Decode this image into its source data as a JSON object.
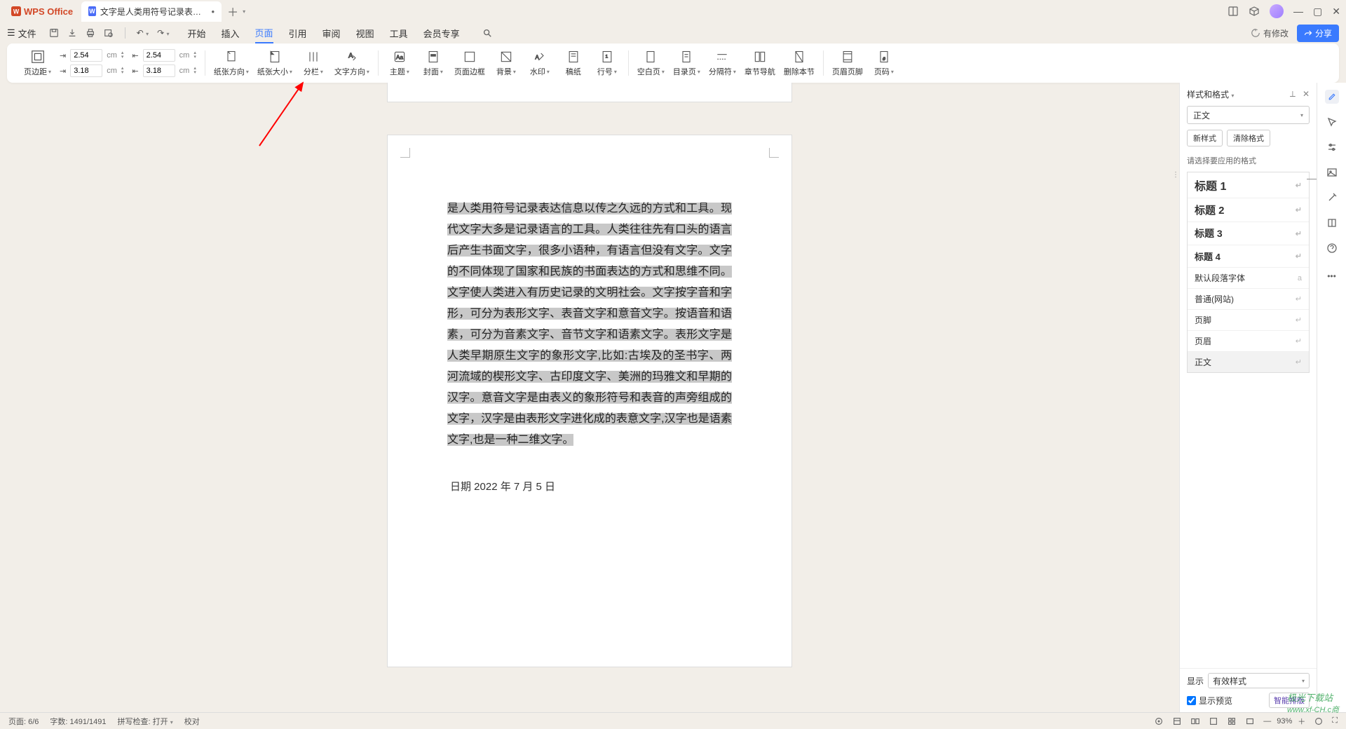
{
  "app": {
    "name": "WPS Office"
  },
  "tab": {
    "title": "文字是人类用符号记录表达信息以…"
  },
  "menubar": {
    "file": "文件",
    "tabs": [
      "开始",
      "插入",
      "页面",
      "引用",
      "审阅",
      "视图",
      "工具",
      "会员专享"
    ],
    "active_index": 2,
    "modified": "有修改",
    "share": "分享"
  },
  "ribbon": {
    "margins": {
      "label": "页边距",
      "top": "2.54",
      "bottom": "2.54",
      "left": "3.18",
      "right": "3.18",
      "unit": "cm"
    },
    "buttons": {
      "paper_orient": "纸张方向",
      "paper_size": "纸张大小",
      "columns": "分栏",
      "text_dir": "文字方向",
      "theme": "主题",
      "cover": "封面",
      "page_border": "页面边框",
      "background": "背景",
      "watermark": "水印",
      "manuscript": "稿纸",
      "line_no": "行号",
      "blank_page": "空白页",
      "toc_page": "目录页",
      "section_break": "分隔符",
      "chapter_nav": "章节导航",
      "delete_section": "删除本节",
      "header_footer": "页眉页脚",
      "page_number": "页码"
    }
  },
  "document": {
    "body_selected": "是人类用符号记录表达信息以传之久远的方式和工具。现代文字大多是记录语言的工具。人类往往先有口头的语言后产生书面文字，很多小语种，有语言但没有文字。文字的不同体现了国家和民族的书面表达的方式和思维不同。文字使人类进入有历史记录的文明社会。文字按字音和字形，可分为表形文字、表音文字和意音文字。按语音和语素，可分为音素文字、音节文字和语素文字。表形文字是人类早期原生文字的象形文字,比如:古埃及的圣书字、两河流域的楔形文字、古印度文字、美洲的玛雅文和早期的汉字。意音文字是由表义的象形符号和表音的声旁组成的文字，汉字是由表形文字进化成的表意文字,汉字也是语素文字,",
    "body_tail": "也是一种二维文字。",
    "footer_date": "日期    2022 年 7 月 5 日"
  },
  "styles_panel": {
    "title": "样式和格式",
    "current": "正文",
    "new_style": "新样式",
    "clear_format": "清除格式",
    "hint": "请选择要应用的格式",
    "items": [
      {
        "label": "标题 1",
        "cls": "s1"
      },
      {
        "label": "标题 2",
        "cls": "s2"
      },
      {
        "label": "标题 3",
        "cls": "s3"
      },
      {
        "label": "标题 4",
        "cls": "s4"
      },
      {
        "label": "默认段落字体",
        "cls": ""
      },
      {
        "label": "普通(网站)",
        "cls": ""
      },
      {
        "label": "页脚",
        "cls": ""
      },
      {
        "label": "页眉",
        "cls": ""
      },
      {
        "label": "正文",
        "cls": "selected"
      }
    ],
    "display_label": "显示",
    "display_value": "有效样式",
    "preview_chk": "显示预览",
    "smart": "智能排版"
  },
  "statusbar": {
    "page": "页面: 6/6",
    "words": "字数: 1491/1491",
    "spell": "拼写检查: 打开",
    "proof": "校对",
    "zoom": "93%"
  },
  "watermark": {
    "line1": "极光下载站",
    "line2": "www.xf-CH.c商"
  }
}
